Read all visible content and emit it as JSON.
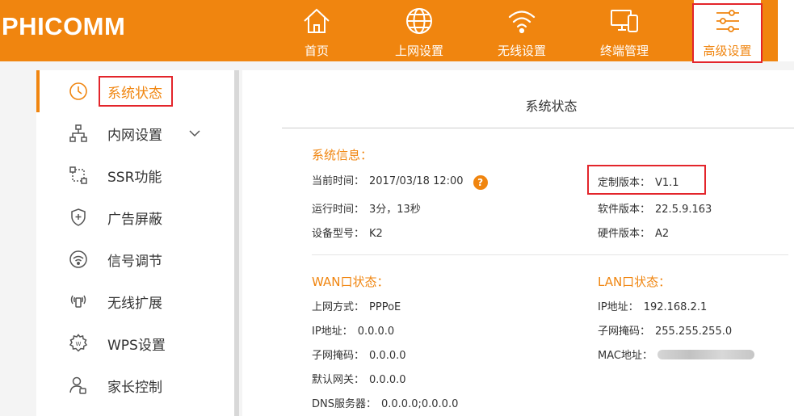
{
  "header": {
    "logo": "PHICOMM",
    "nav": [
      {
        "label": "首页",
        "icon": "home-icon"
      },
      {
        "label": "上网设置",
        "icon": "globe-icon"
      },
      {
        "label": "无线设置",
        "icon": "wifi-icon"
      },
      {
        "label": "终端管理",
        "icon": "devices-icon"
      },
      {
        "label": "高级设置",
        "icon": "sliders-icon",
        "active": true
      }
    ]
  },
  "sidebar": {
    "items": [
      {
        "label": "系统状态",
        "icon": "clock-icon",
        "active": true
      },
      {
        "label": "内网设置",
        "icon": "network-icon",
        "expandable": true
      },
      {
        "label": "SSR功能",
        "icon": "ssr-icon"
      },
      {
        "label": "广告屏蔽",
        "icon": "shield-icon"
      },
      {
        "label": "信号调节",
        "icon": "signal-icon"
      },
      {
        "label": "无线扩展",
        "icon": "extend-icon"
      },
      {
        "label": "WPS设置",
        "icon": "wps-gear-icon"
      },
      {
        "label": "家长控制",
        "icon": "parent-icon"
      }
    ]
  },
  "main": {
    "title": "系统状态",
    "system_info": {
      "title": "系统信息：",
      "current_time_label": "当前时间：",
      "current_time_value": "2017/03/18 12:00",
      "help": "?",
      "uptime_label": "运行时间：",
      "uptime_value": "3分，13秒",
      "model_label": "设备型号：",
      "model_value": "K2",
      "custom_version_label": "定制版本：",
      "custom_version_value": "V1.1",
      "software_version_label": "软件版本：",
      "software_version_value": "22.5.9.163",
      "hardware_version_label": "硬件版本：",
      "hardware_version_value": "A2"
    },
    "wan": {
      "title": "WAN口状态：",
      "mode_label": "上网方式：",
      "mode_value": "PPPoE",
      "ip_label": "IP地址：",
      "ip_value": "0.0.0.0",
      "mask_label": "子网掩码：",
      "mask_value": "0.0.0.0",
      "gateway_label": "默认网关：",
      "gateway_value": "0.0.0.0",
      "dns_label": "DNS服务器：",
      "dns_value": "0.0.0.0;0.0.0.0"
    },
    "lan": {
      "title": "LAN口状态：",
      "ip_label": "IP地址：",
      "ip_value": "192.168.2.1",
      "mask_label": "子网掩码：",
      "mask_value": "255.255.255.0",
      "mac_label": "MAC地址："
    }
  },
  "colors": {
    "accent": "#f0850f",
    "highlight_frame": "#e3252b"
  }
}
